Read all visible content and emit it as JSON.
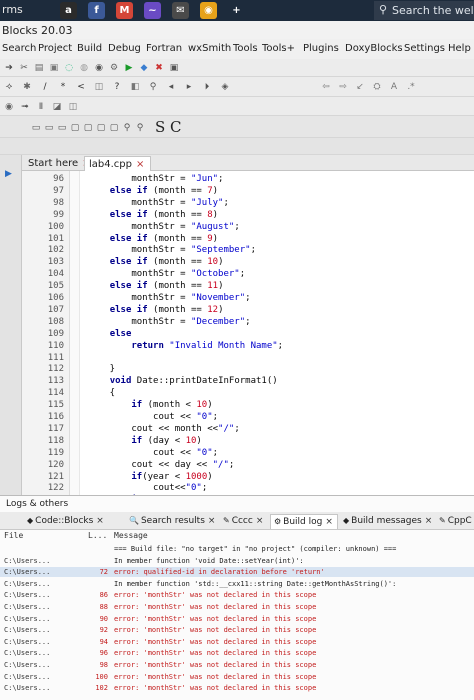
{
  "taskbar": {
    "left_text": "rms",
    "search_placeholder": "Search the wel",
    "icons": [
      {
        "name": "amazon-icon",
        "glyph": "a",
        "color": "#2b2b2b"
      },
      {
        "name": "facebook-icon",
        "glyph": "f",
        "color": "#3b5998"
      },
      {
        "name": "gmail-icon",
        "glyph": "M",
        "color": "#d44638"
      },
      {
        "name": "app-icon",
        "glyph": "~",
        "color": "#6a4bc4"
      },
      {
        "name": "mail-icon",
        "glyph": "✉",
        "color": "#4a4a4a"
      },
      {
        "name": "chrome-icon",
        "glyph": "◉",
        "color": "#e7a21a"
      },
      {
        "name": "new-tab-icon",
        "glyph": "+",
        "color": "transparent"
      }
    ]
  },
  "app": {
    "title": "Blocks 20.03",
    "menu": [
      "Search",
      "Project",
      "Build",
      "Debug",
      "Fortran",
      "wxSmith",
      "Tools",
      "Tools+",
      "Plugins",
      "DoxyBlocks",
      "Settings",
      "Help"
    ]
  },
  "toolbar": {
    "row4_letters": [
      "S",
      "C"
    ]
  },
  "editor": {
    "tabs": [
      {
        "label": "Start here",
        "active": false
      },
      {
        "label": "lab4.cpp",
        "active": true
      }
    ],
    "lines": [
      {
        "n": "96",
        "segs": [
          [
            "t",
            "        monthStr = "
          ],
          [
            "s",
            "\"Jun\""
          ],
          [
            "t",
            ";"
          ]
        ]
      },
      {
        "n": "97",
        "segs": [
          [
            "t",
            "    "
          ],
          [
            "k",
            "else if"
          ],
          [
            "t",
            " (month == "
          ],
          [
            "n",
            "7"
          ],
          [
            "t",
            ")"
          ]
        ]
      },
      {
        "n": "98",
        "segs": [
          [
            "t",
            "        monthStr = "
          ],
          [
            "s",
            "\"July\""
          ],
          [
            "t",
            ";"
          ]
        ]
      },
      {
        "n": "99",
        "segs": [
          [
            "t",
            "    "
          ],
          [
            "k",
            "else if"
          ],
          [
            "t",
            " (month == "
          ],
          [
            "n",
            "8"
          ],
          [
            "t",
            ")"
          ]
        ]
      },
      {
        "n": "100",
        "segs": [
          [
            "t",
            "        monthStr = "
          ],
          [
            "s",
            "\"August\""
          ],
          [
            "t",
            ";"
          ]
        ]
      },
      {
        "n": "101",
        "segs": [
          [
            "t",
            "    "
          ],
          [
            "k",
            "else if"
          ],
          [
            "t",
            " (month == "
          ],
          [
            "n",
            "9"
          ],
          [
            "t",
            ")"
          ]
        ]
      },
      {
        "n": "102",
        "segs": [
          [
            "t",
            "        monthStr = "
          ],
          [
            "s",
            "\"September\""
          ],
          [
            "t",
            ";"
          ]
        ]
      },
      {
        "n": "103",
        "segs": [
          [
            "t",
            "    "
          ],
          [
            "k",
            "else if"
          ],
          [
            "t",
            " (month == "
          ],
          [
            "n",
            "10"
          ],
          [
            "t",
            ")"
          ]
        ]
      },
      {
        "n": "104",
        "segs": [
          [
            "t",
            "        monthStr = "
          ],
          [
            "s",
            "\"October\""
          ],
          [
            "t",
            ";"
          ]
        ]
      },
      {
        "n": "105",
        "segs": [
          [
            "t",
            "    "
          ],
          [
            "k",
            "else if"
          ],
          [
            "t",
            " (month == "
          ],
          [
            "n",
            "11"
          ],
          [
            "t",
            ")"
          ]
        ]
      },
      {
        "n": "106",
        "segs": [
          [
            "t",
            "        monthStr = "
          ],
          [
            "s",
            "\"November\""
          ],
          [
            "t",
            ";"
          ]
        ]
      },
      {
        "n": "107",
        "segs": [
          [
            "t",
            "    "
          ],
          [
            "k",
            "else if"
          ],
          [
            "t",
            " (month == "
          ],
          [
            "n",
            "12"
          ],
          [
            "t",
            ")"
          ]
        ]
      },
      {
        "n": "108",
        "segs": [
          [
            "t",
            "        monthStr = "
          ],
          [
            "s",
            "\"December\""
          ],
          [
            "t",
            ";"
          ]
        ]
      },
      {
        "n": "109",
        "segs": [
          [
            "t",
            "    "
          ],
          [
            "k",
            "else"
          ]
        ]
      },
      {
        "n": "110",
        "segs": [
          [
            "t",
            "        "
          ],
          [
            "k",
            "return"
          ],
          [
            "t",
            " "
          ],
          [
            "s",
            "\"Invalid Month Name\""
          ],
          [
            "t",
            ";"
          ]
        ]
      },
      {
        "n": "111",
        "segs": [
          [
            "t",
            ""
          ]
        ]
      },
      {
        "n": "112",
        "segs": [
          [
            "t",
            "    }"
          ]
        ]
      },
      {
        "n": "113",
        "segs": [
          [
            "t",
            "    "
          ],
          [
            "k",
            "void"
          ],
          [
            "t",
            " Date::printDateInFormat1()"
          ]
        ]
      },
      {
        "n": "114",
        "segs": [
          [
            "t",
            "    {"
          ]
        ]
      },
      {
        "n": "115",
        "segs": [
          [
            "t",
            "        "
          ],
          [
            "k",
            "if"
          ],
          [
            "t",
            " (month < "
          ],
          [
            "n",
            "10"
          ],
          [
            "t",
            ")"
          ]
        ]
      },
      {
        "n": "116",
        "segs": [
          [
            "t",
            "            cout << "
          ],
          [
            "s",
            "\"0\""
          ],
          [
            "t",
            ";"
          ]
        ]
      },
      {
        "n": "117",
        "segs": [
          [
            "t",
            "        cout << month <<"
          ],
          [
            "s",
            "\"/\""
          ],
          [
            "t",
            ";"
          ]
        ]
      },
      {
        "n": "118",
        "segs": [
          [
            "t",
            "        "
          ],
          [
            "k",
            "if"
          ],
          [
            "t",
            " (day < "
          ],
          [
            "n",
            "10"
          ],
          [
            "t",
            ")"
          ]
        ]
      },
      {
        "n": "119",
        "segs": [
          [
            "t",
            "            cout << "
          ],
          [
            "s",
            "\"0\""
          ],
          [
            "t",
            ";"
          ]
        ]
      },
      {
        "n": "120",
        "segs": [
          [
            "t",
            "        cout << day << "
          ],
          [
            "s",
            "\"/\""
          ],
          [
            "t",
            ";"
          ]
        ]
      },
      {
        "n": "121",
        "segs": [
          [
            "t",
            "        "
          ],
          [
            "k",
            "if"
          ],
          [
            "t",
            "(year < "
          ],
          [
            "n",
            "1000"
          ],
          [
            "t",
            ")"
          ]
        ]
      },
      {
        "n": "122",
        "segs": [
          [
            "t",
            "            cout<<"
          ],
          [
            "s",
            "\"0\""
          ],
          [
            "t",
            ";"
          ]
        ]
      },
      {
        "n": "123",
        "segs": [
          [
            "t",
            "        "
          ],
          [
            "k",
            "if"
          ],
          [
            "t",
            "(year < "
          ],
          [
            "n",
            "100"
          ],
          [
            "t",
            ")"
          ]
        ]
      }
    ]
  },
  "logs": {
    "title": "Logs & others",
    "tabs": [
      {
        "label": "Code::Blocks",
        "icon": "◆"
      },
      {
        "label": "Search results",
        "icon": "🔍"
      },
      {
        "label": "Cccc",
        "icon": "✎"
      },
      {
        "label": "Build log",
        "icon": "⚙",
        "active": true
      },
      {
        "label": "Build messages",
        "icon": "◆"
      },
      {
        "label": "CppC",
        "icon": "✎"
      }
    ],
    "header": {
      "file": "File",
      "line": "L...",
      "message": "Message"
    },
    "rows": [
      {
        "file": "",
        "line": "",
        "msg": "=== Build file: \"no target\" in \"no project\" (compiler: unknown) ===",
        "type": "info"
      },
      {
        "file": "C:\\Users...",
        "line": "",
        "msg": "In member function 'void Date::setYear(int)':",
        "type": "info"
      },
      {
        "file": "C:\\Users...",
        "line": "72",
        "msg": "error: qualified-id in declaration before 'return'",
        "type": "err",
        "selected": true
      },
      {
        "file": "C:\\Users...",
        "line": "",
        "msg": "In member function 'std::__cxx11::string Date::getMonthAsString()':",
        "type": "info"
      },
      {
        "file": "C:\\Users...",
        "line": "86",
        "msg": "error: 'monthStr' was not declared in this scope",
        "type": "err"
      },
      {
        "file": "C:\\Users...",
        "line": "88",
        "msg": "error: 'monthStr' was not declared in this scope",
        "type": "err"
      },
      {
        "file": "C:\\Users...",
        "line": "90",
        "msg": "error: 'monthStr' was not declared in this scope",
        "type": "err"
      },
      {
        "file": "C:\\Users...",
        "line": "92",
        "msg": "error: 'monthStr' was not declared in this scope",
        "type": "err"
      },
      {
        "file": "C:\\Users...",
        "line": "94",
        "msg": "error: 'monthStr' was not declared in this scope",
        "type": "err"
      },
      {
        "file": "C:\\Users...",
        "line": "96",
        "msg": "error: 'monthStr' was not declared in this scope",
        "type": "err"
      },
      {
        "file": "C:\\Users...",
        "line": "98",
        "msg": "error: 'monthStr' was not declared in this scope",
        "type": "err"
      },
      {
        "file": "C:\\Users...",
        "line": "100",
        "msg": "error: 'monthStr' was not declared in this scope",
        "type": "err"
      },
      {
        "file": "C:\\Users...",
        "line": "102",
        "msg": "error: 'monthStr' was not declared in this scope",
        "type": "err"
      }
    ]
  },
  "colors": {
    "keyword": "#00008b",
    "string": "#0000cc",
    "number": "#c8001e",
    "error": "#c21a1a"
  }
}
